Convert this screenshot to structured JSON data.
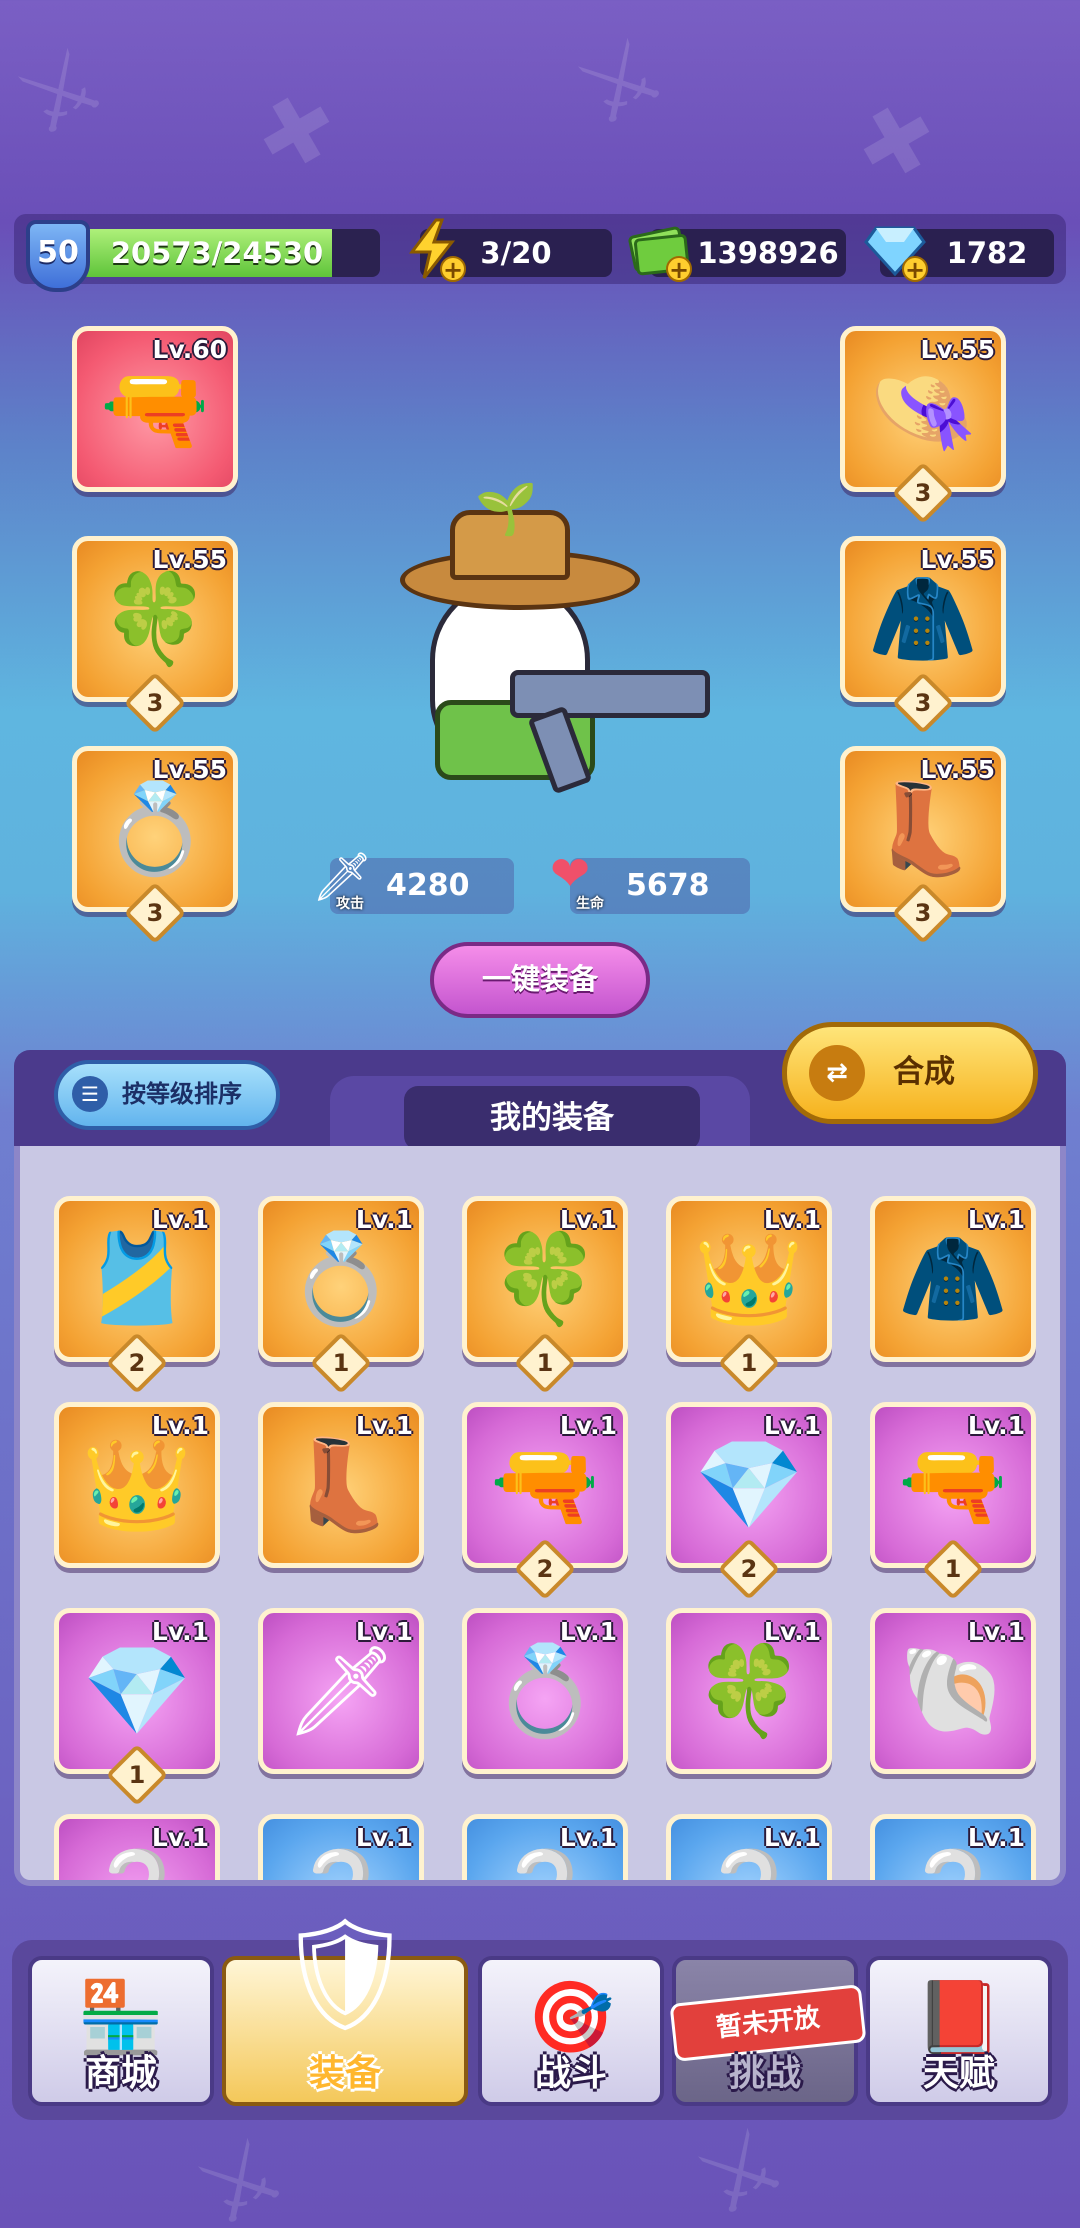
{
  "player": {
    "level": "50",
    "xp": "20573/24530",
    "xp_progress": 0.839
  },
  "resources": {
    "energy": "3/20",
    "cash": "1398926",
    "gems": "1782"
  },
  "equipped": {
    "left": [
      {
        "level": "Lv.60",
        "icon": "rifle-icon",
        "rarity": "red",
        "stars": ""
      },
      {
        "level": "Lv.55",
        "icon": "clover-necklace-icon",
        "rarity": "orange",
        "stars": "3"
      },
      {
        "level": "Lv.55",
        "icon": "eye-ring-icon",
        "rarity": "orange",
        "stars": "3"
      }
    ],
    "right": [
      {
        "level": "Lv.55",
        "icon": "straw-hat-icon",
        "rarity": "orange",
        "stars": "3"
      },
      {
        "level": "Lv.55",
        "icon": "jacket-icon",
        "rarity": "orange",
        "stars": "3"
      },
      {
        "level": "Lv.55",
        "icon": "boots-icon",
        "rarity": "orange",
        "stars": "3"
      }
    ]
  },
  "stats": {
    "attack_value": "4280",
    "attack_label": "攻击",
    "hp_value": "5678",
    "hp_label": "生命"
  },
  "buttons": {
    "equip_all": "一键装备",
    "sort": "按等级排序",
    "merge": "合成"
  },
  "inventory": {
    "title": "我的装备",
    "items": [
      {
        "level": "Lv.1",
        "icon": "jersey-icon",
        "rarity": "orange",
        "stars": "2"
      },
      {
        "level": "Lv.1",
        "icon": "eye-ring-icon",
        "rarity": "orange",
        "stars": "1"
      },
      {
        "level": "Lv.1",
        "icon": "clover-necklace-icon",
        "rarity": "orange",
        "stars": "1"
      },
      {
        "level": "Lv.1",
        "icon": "cake-crown-icon",
        "rarity": "orange",
        "stars": "1"
      },
      {
        "level": "Lv.1",
        "icon": "jacket-icon",
        "rarity": "orange",
        "stars": ""
      },
      {
        "level": "Lv.1",
        "icon": "cake-crown-icon",
        "rarity": "orange",
        "stars": ""
      },
      {
        "level": "Lv.1",
        "icon": "boots-icon",
        "rarity": "orange",
        "stars": ""
      },
      {
        "level": "Lv.1",
        "icon": "revolver-icon",
        "rarity": "purple",
        "stars": "2"
      },
      {
        "level": "Lv.1",
        "icon": "gem-ring-icon",
        "rarity": "purple",
        "stars": "2"
      },
      {
        "level": "Lv.1",
        "icon": "revolver-icon",
        "rarity": "purple",
        "stars": "1"
      },
      {
        "level": "Lv.1",
        "icon": "gem-ring-icon",
        "rarity": "purple",
        "stars": "1"
      },
      {
        "level": "Lv.1",
        "icon": "sword-icon",
        "rarity": "purple",
        "stars": ""
      },
      {
        "level": "Lv.1",
        "icon": "eye-ring-icon",
        "rarity": "purple",
        "stars": ""
      },
      {
        "level": "Lv.1",
        "icon": "clover-necklace-icon",
        "rarity": "purple",
        "stars": ""
      },
      {
        "level": "Lv.1",
        "icon": "shell-necklace-icon",
        "rarity": "purple",
        "stars": ""
      },
      {
        "level": "Lv.1",
        "icon": "item-icon",
        "rarity": "purple",
        "stars": ""
      },
      {
        "level": "Lv.1",
        "icon": "item-icon",
        "rarity": "blue",
        "stars": ""
      },
      {
        "level": "Lv.1",
        "icon": "item-icon",
        "rarity": "blue",
        "stars": ""
      },
      {
        "level": "Lv.1",
        "icon": "item-icon",
        "rarity": "blue",
        "stars": ""
      },
      {
        "level": "Lv.1",
        "icon": "item-icon",
        "rarity": "blue",
        "stars": ""
      }
    ]
  },
  "nav": {
    "shop": "商城",
    "equipment": "装备",
    "battle": "战斗",
    "challenge": "挑战",
    "challenge_locked": "暂未开放",
    "talent": "天赋"
  }
}
